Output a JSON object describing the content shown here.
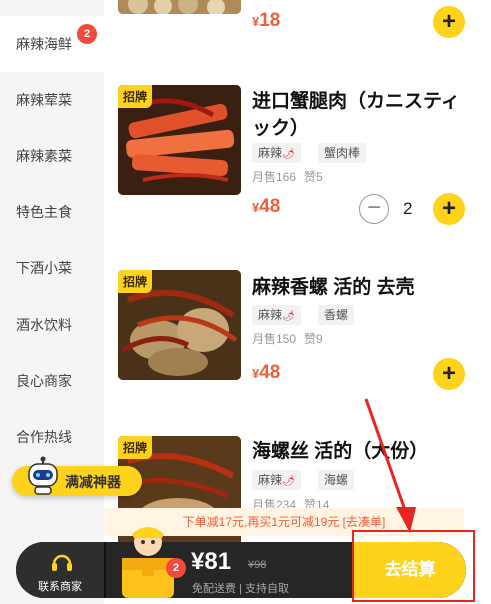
{
  "sidebar": {
    "categories": [
      {
        "label": "麻辣海鲜",
        "badge": "2"
      },
      {
        "label": "麻辣荤菜"
      },
      {
        "label": "麻辣素菜"
      },
      {
        "label": "特色主食"
      },
      {
        "label": "下酒小菜"
      },
      {
        "label": "酒水饮料"
      },
      {
        "label": "良心商家"
      },
      {
        "label": "合作热线"
      }
    ]
  },
  "products": [
    {
      "price_symbol": "¥",
      "price": "18"
    },
    {
      "badge": "招牌",
      "title": "进口蟹腿肉（カニスティック）",
      "tags": [
        "麻辣",
        "蟹肉棒"
      ],
      "monthly_sales": "月售166",
      "likes": "赞5",
      "price_symbol": "¥",
      "price": "48",
      "quantity": "2"
    },
    {
      "badge": "招牌",
      "title": "麻辣香螺 活的 去壳",
      "tags": [
        "麻辣",
        "香螺"
      ],
      "monthly_sales": "月售150",
      "likes": "赞9",
      "price_symbol": "¥",
      "price": "48"
    },
    {
      "badge": "招牌",
      "title": "海螺丝 活的（大份）",
      "tags": [
        "麻辣",
        "海螺"
      ],
      "monthly_sales": "月售234",
      "likes": "赞14"
    }
  ],
  "promo_tip": "下单减17元,再买1元可减19元 [去凑单]",
  "promo_tool": "满减神器",
  "cart": {
    "contact_label": "联系商家",
    "badge": "2",
    "total": "¥81",
    "original_total": "¥98",
    "shipping": "免配送费 | 支持自取",
    "checkout_label": "去结算"
  },
  "colors": {
    "accent_yellow": "#ffd21c",
    "price_red": "#f25d3a",
    "annotation_red": "#e8261f",
    "bar_dark": "#262626"
  },
  "icons": [
    "plus-icon",
    "minus-icon",
    "chili-icon",
    "headset-icon",
    "robot-icon",
    "cart-mascot-icon",
    "annotation-arrow"
  ]
}
